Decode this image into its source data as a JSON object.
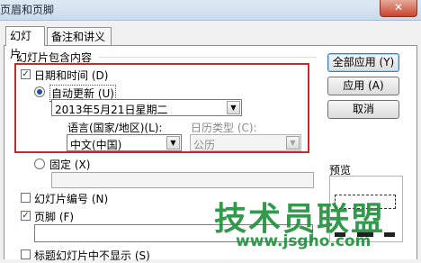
{
  "window": {
    "title": "页眉和页脚",
    "close_glyph": "✕"
  },
  "tabs": [
    {
      "label": "幻灯片"
    },
    {
      "label": "备注和讲义"
    }
  ],
  "group": {
    "title": "幻灯片包含内容"
  },
  "datetime": {
    "label": "日期和时间 (D)",
    "checked": true,
    "auto_update": {
      "label": "自动更新 (U)",
      "selected": true
    },
    "date_value": "2013年5月21日星期二",
    "language_label": "语言(国家/地区)(L):",
    "language_value": "中文(中国)",
    "calendar_label": "日历类型 (C):",
    "calendar_value": "公历"
  },
  "fixed": {
    "label": "固定 (X)",
    "selected": false
  },
  "slide_number": {
    "label": "幻灯片编号 (N)",
    "checked": false
  },
  "footer": {
    "label": "页脚 (F)",
    "checked": true
  },
  "hide_title": {
    "label": "标题幻灯片中不显示 (S)",
    "checked": false
  },
  "buttons": {
    "apply_all": "全部应用 (Y)",
    "apply": "应用 (A)",
    "cancel": "取消"
  },
  "preview_label": "预览",
  "watermark": {
    "text": "技术员联盟",
    "url": "www.jsgho.com"
  },
  "colors": {
    "highlight": "#c8292b",
    "watermark": "#1f8f3a"
  }
}
